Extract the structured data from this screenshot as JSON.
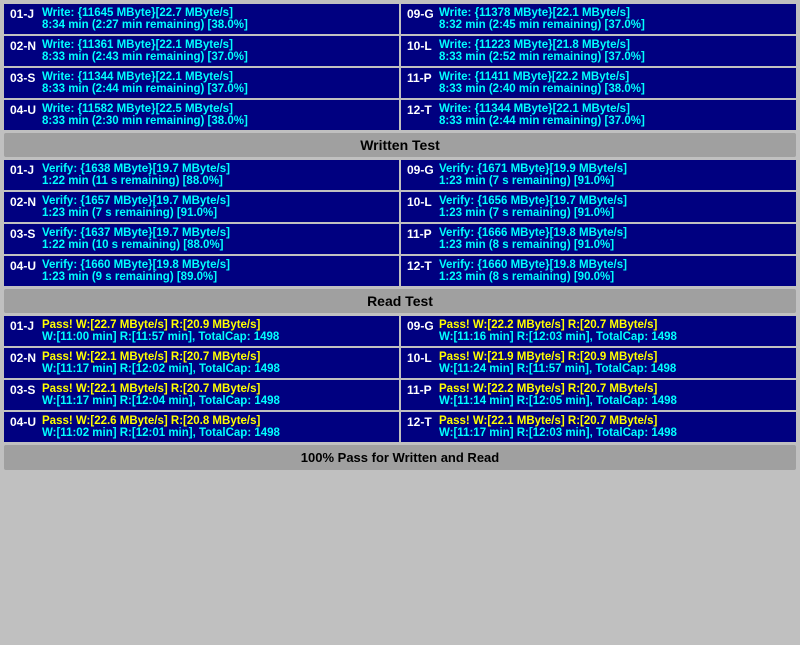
{
  "headers": {
    "written_test": "Written Test",
    "read_test": "Read Test",
    "footer": "100% Pass for Written and Read"
  },
  "write_section": {
    "cells": [
      {
        "id": "01-J",
        "line1": "Write: {11645 MByte}[22.7 MByte/s]",
        "line2": "8:34 min (2:27 min remaining)  [38.0%]"
      },
      {
        "id": "09-G",
        "line1": "Write: {11378 MByte}[22.1 MByte/s]",
        "line2": "8:32 min (2:45 min remaining)  [37.0%]"
      },
      {
        "id": "02-N",
        "line1": "Write: {11361 MByte}[22.1 MByte/s]",
        "line2": "8:33 min (2:43 min remaining)  [37.0%]"
      },
      {
        "id": "10-L",
        "line1": "Write: {11223 MByte}[21.8 MByte/s]",
        "line2": "8:33 min (2:52 min remaining)  [37.0%]"
      },
      {
        "id": "03-S",
        "line1": "Write: {11344 MByte}[22.1 MByte/s]",
        "line2": "8:33 min (2:44 min remaining)  [37.0%]"
      },
      {
        "id": "11-P",
        "line1": "Write: {11411 MByte}[22.2 MByte/s]",
        "line2": "8:33 min (2:40 min remaining)  [38.0%]"
      },
      {
        "id": "04-U",
        "line1": "Write: {11582 MByte}[22.5 MByte/s]",
        "line2": "8:33 min (2:30 min remaining)  [38.0%]"
      },
      {
        "id": "12-T",
        "line1": "Write: {11344 MByte}[22.1 MByte/s]",
        "line2": "8:33 min (2:44 min remaining)  [37.0%]"
      }
    ]
  },
  "verify_section": {
    "cells": [
      {
        "id": "01-J",
        "line1": "Verify: {1638 MByte}[19.7 MByte/s]",
        "line2": "1:22 min (11 s remaining)  [88.0%]"
      },
      {
        "id": "09-G",
        "line1": "Verify: {1671 MByte}[19.9 MByte/s]",
        "line2": "1:23 min (7 s remaining)  [91.0%]"
      },
      {
        "id": "02-N",
        "line1": "Verify: {1657 MByte}[19.7 MByte/s]",
        "line2": "1:23 min (7 s remaining)  [91.0%]"
      },
      {
        "id": "10-L",
        "line1": "Verify: {1656 MByte}[19.7 MByte/s]",
        "line2": "1:23 min (7 s remaining)  [91.0%]"
      },
      {
        "id": "03-S",
        "line1": "Verify: {1637 MByte}[19.7 MByte/s]",
        "line2": "1:22 min (10 s remaining)  [88.0%]"
      },
      {
        "id": "11-P",
        "line1": "Verify: {1666 MByte}[19.8 MByte/s]",
        "line2": "1:23 min (8 s remaining)  [91.0%]"
      },
      {
        "id": "04-U",
        "line1": "Verify: {1660 MByte}[19.8 MByte/s]",
        "line2": "1:23 min (9 s remaining)  [89.0%]"
      },
      {
        "id": "12-T",
        "line1": "Verify: {1660 MByte}[19.8 MByte/s]",
        "line2": "1:23 min (8 s remaining)  [90.0%]"
      }
    ]
  },
  "pass_section": {
    "cells": [
      {
        "id": "01-J",
        "line1": "Pass! W:[22.7 MByte/s] R:[20.9 MByte/s]",
        "line2": "W:[11:00 min] R:[11:57 min], TotalCap: 1498"
      },
      {
        "id": "09-G",
        "line1": "Pass! W:[22.2 MByte/s] R:[20.7 MByte/s]",
        "line2": "W:[11:16 min] R:[12:03 min], TotalCap: 1498"
      },
      {
        "id": "02-N",
        "line1": "Pass! W:[22.1 MByte/s] R:[20.7 MByte/s]",
        "line2": "W:[11:17 min] R:[12:02 min], TotalCap: 1498"
      },
      {
        "id": "10-L",
        "line1": "Pass! W:[21.9 MByte/s] R:[20.9 MByte/s]",
        "line2": "W:[11:24 min] R:[11:57 min], TotalCap: 1498"
      },
      {
        "id": "03-S",
        "line1": "Pass! W:[22.1 MByte/s] R:[20.7 MByte/s]",
        "line2": "W:[11:17 min] R:[12:04 min], TotalCap: 1498"
      },
      {
        "id": "11-P",
        "line1": "Pass! W:[22.2 MByte/s] R:[20.7 MByte/s]",
        "line2": "W:[11:14 min] R:[12:05 min], TotalCap: 1498"
      },
      {
        "id": "04-U",
        "line1": "Pass! W:[22.6 MByte/s] R:[20.8 MByte/s]",
        "line2": "W:[11:02 min] R:[12:01 min], TotalCap: 1498"
      },
      {
        "id": "12-T",
        "line1": "Pass! W:[22.1 MByte/s] R:[20.7 MByte/s]",
        "line2": "W:[11:17 min] R:[12:03 min], TotalCap: 1498"
      }
    ]
  }
}
